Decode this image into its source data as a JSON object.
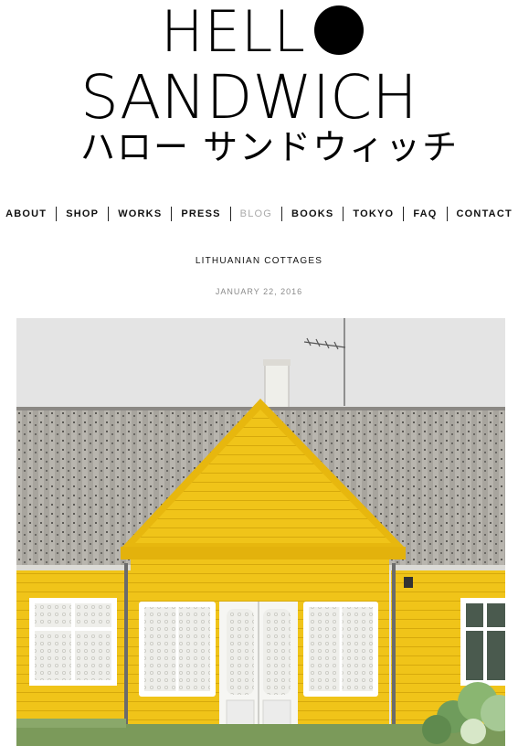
{
  "logo": {
    "line1": "HELL",
    "line2": "SANDWICH",
    "line3": "ハロー サンドウィッチ"
  },
  "nav": [
    {
      "label": "ABOUT",
      "active": false
    },
    {
      "label": "SHOP",
      "active": false
    },
    {
      "label": "WORKS",
      "active": false
    },
    {
      "label": "PRESS",
      "active": false
    },
    {
      "label": "BLOG",
      "active": true
    },
    {
      "label": "BOOKS",
      "active": false
    },
    {
      "label": "TOKYO",
      "active": false
    },
    {
      "label": "FAQ",
      "active": false
    },
    {
      "label": "CONTACT",
      "active": false
    }
  ],
  "post": {
    "title": "LITHUANIAN COTTAGES",
    "date": "JANUARY 22, 2016"
  },
  "colors": {
    "house_yellow": "#f0c419",
    "roof_grey": "#a9a6a0",
    "sky": "#e4e4e4",
    "nav_active": "#aaaaaa"
  }
}
